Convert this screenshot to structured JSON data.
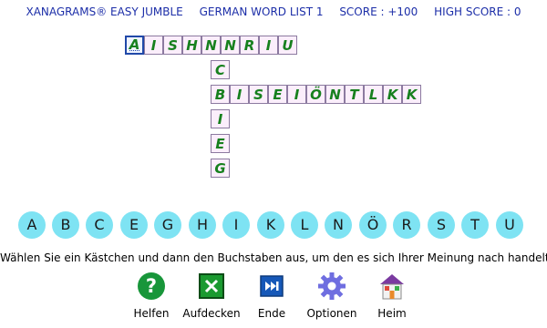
{
  "header": {
    "title": "XANAGRAMS® EASY JUMBLE",
    "word_list": "GERMAN WORD LIST 1",
    "score": "SCORE : +100",
    "high_score": "HIGH SCORE : 0"
  },
  "grid": {
    "row1": [
      "A",
      "I",
      "S",
      "H",
      "N",
      "N",
      "R",
      "I",
      "U"
    ],
    "column_down": [
      "N",
      "C",
      "B",
      "I",
      "E",
      "G"
    ],
    "row3": [
      "B",
      "I",
      "S",
      "E",
      "I",
      "Ö",
      "N",
      "T",
      "L",
      "K"
    ]
  },
  "letters": [
    "A",
    "B",
    "C",
    "E",
    "G",
    "H",
    "I",
    "K",
    "L",
    "N",
    "Ö",
    "R",
    "S",
    "T",
    "U"
  ],
  "instruction": "Wählen Sie ein Kästchen und dann den Buchstaben aus, um den es sich Ihrer Meinung nach handelt",
  "toolbar": {
    "help": "Helfen",
    "reveal": "Aufdecken",
    "end": "Ende",
    "options": "Optionen",
    "home": "Heim"
  },
  "colors": {
    "letter_text": "#17801e",
    "cell_bg": "#fbeefb",
    "bubble": "#7ee3f3",
    "header_text": "#1c2ea8"
  },
  "icons": [
    "help-icon",
    "reveal-icon",
    "end-icon",
    "options-icon",
    "home-icon"
  ]
}
